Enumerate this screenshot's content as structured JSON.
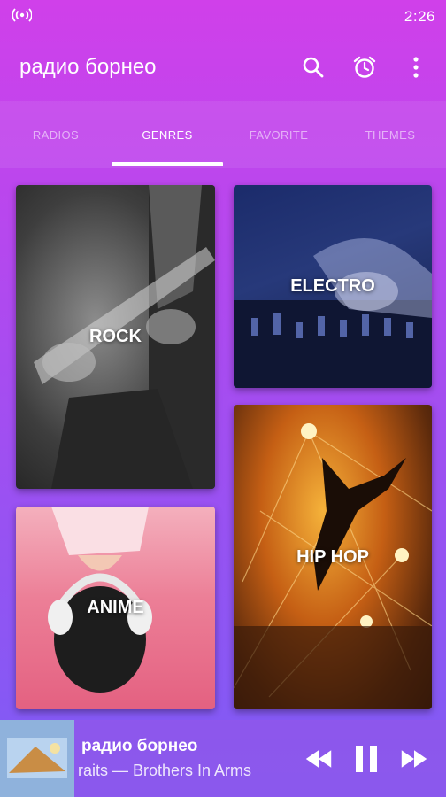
{
  "status_bar": {
    "time": "2:26",
    "signal_icon": "broadcast-icon"
  },
  "app_bar": {
    "title": "радио борнео",
    "actions": [
      "search-icon",
      "alarm-clock-icon",
      "more-vert-icon"
    ]
  },
  "tabs": [
    {
      "label": "RADIOS",
      "active": false
    },
    {
      "label": "GENRES",
      "active": true
    },
    {
      "label": "FAVORITE",
      "active": false
    },
    {
      "label": "THEMES",
      "active": false
    }
  ],
  "genres": [
    {
      "label": "ROCK"
    },
    {
      "label": "ELECTRO"
    },
    {
      "label": "ANIME"
    },
    {
      "label": "HIP HOP"
    }
  ],
  "player": {
    "title": "радио борнео",
    "subtitle": "raits — Brothers In Arms",
    "controls": [
      "rewind-icon",
      "pause-icon",
      "fast-forward-icon"
    ]
  },
  "colors": {
    "gradient_top": "#d040ea",
    "gradient_bottom": "#7d5cf5",
    "accent": "#ffffff"
  }
}
